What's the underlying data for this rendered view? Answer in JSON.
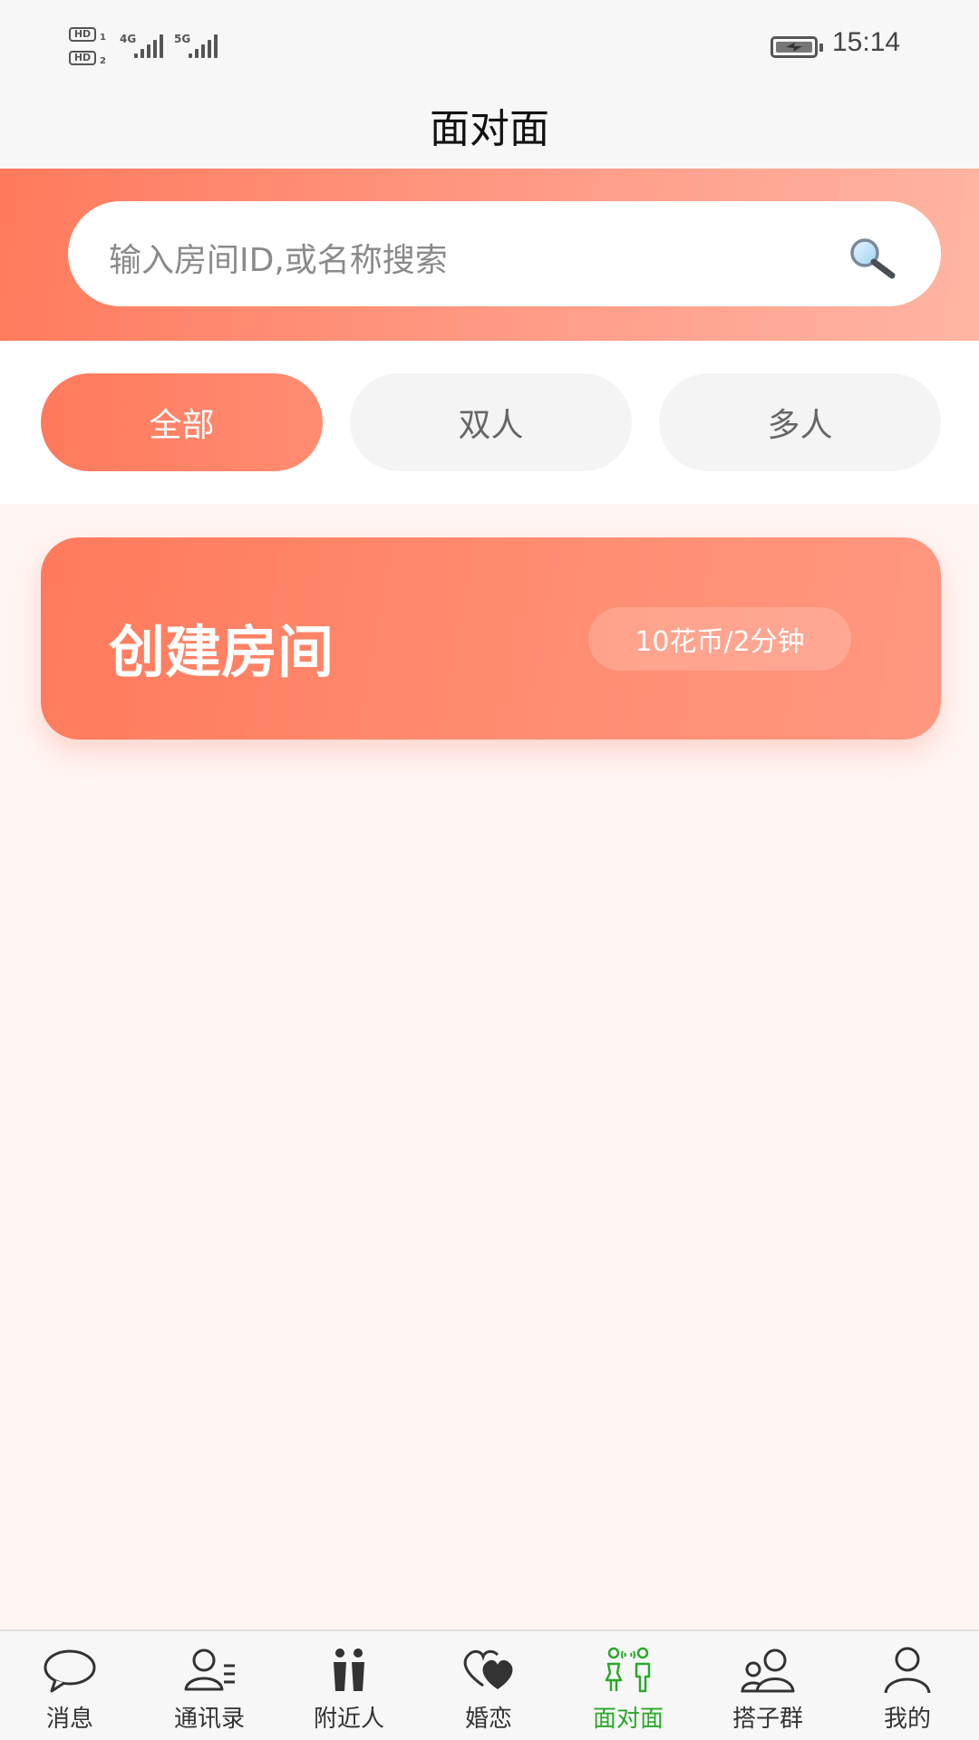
{
  "status_bar": {
    "sim1": "HD",
    "sim1_index": "1",
    "sim2": "HD",
    "sim2_index": "2",
    "net1": "4G",
    "net2": "5G",
    "time": "15:14"
  },
  "header": {
    "title": "面对面"
  },
  "search": {
    "placeholder": "输入房间ID,或名称搜索",
    "icon": "search-icon"
  },
  "filters": [
    {
      "label": "全部",
      "active": true
    },
    {
      "label": "双人",
      "active": false
    },
    {
      "label": "多人",
      "active": false
    }
  ],
  "create_room": {
    "title": "创建房间",
    "price": "10花币/2分钟"
  },
  "colors": {
    "accent": "#ff7a5c",
    "nav_active": "#2aa82a",
    "page_bg": "#fff5f3"
  },
  "bottom_nav": [
    {
      "label": "消息",
      "icon": "chat-bubble-icon"
    },
    {
      "label": "通讯录",
      "icon": "contacts-icon"
    },
    {
      "label": "附近人",
      "icon": "nearby-people-icon"
    },
    {
      "label": "婚恋",
      "icon": "hearts-icon"
    },
    {
      "label": "面对面",
      "icon": "face-to-face-icon",
      "active": true
    },
    {
      "label": "搭子群",
      "icon": "group-icon"
    },
    {
      "label": "我的",
      "icon": "profile-icon"
    }
  ]
}
